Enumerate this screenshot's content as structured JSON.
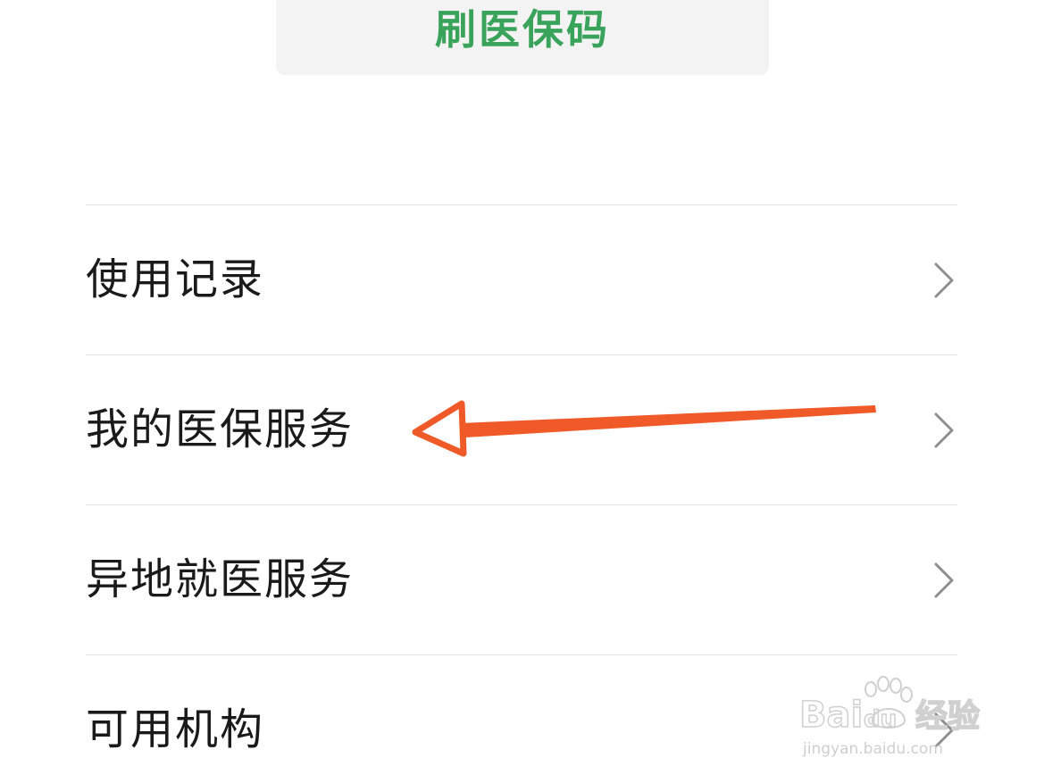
{
  "scan_button": {
    "label": "刷医保码"
  },
  "menu": {
    "items": [
      {
        "label": "使用记录"
      },
      {
        "label": "我的医保服务"
      },
      {
        "label": "异地就医服务"
      },
      {
        "label": "可用机构"
      }
    ]
  },
  "icons": {
    "chevron": "chevron-right-icon",
    "annotation": "arrow-left-annotation"
  },
  "watermark": {
    "brand": "Baidu 经验",
    "url": "jingyan.baidu.com"
  },
  "colors": {
    "accent_green": "#3aa35b",
    "annotation_orange": "#f05a28",
    "text_primary": "#1a1a1a",
    "chevron_gray": "#8e8e8e",
    "divider": "#e6e6e6"
  }
}
